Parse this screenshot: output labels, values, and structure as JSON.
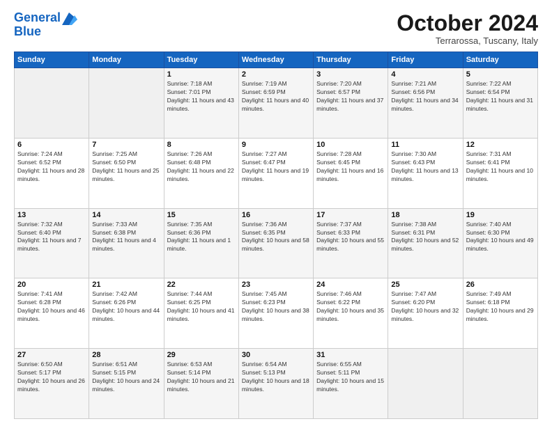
{
  "header": {
    "logo_line1": "General",
    "logo_line2": "Blue",
    "month_title": "October 2024",
    "location": "Terrarossa, Tuscany, Italy"
  },
  "days_of_week": [
    "Sunday",
    "Monday",
    "Tuesday",
    "Wednesday",
    "Thursday",
    "Friday",
    "Saturday"
  ],
  "weeks": [
    [
      {
        "day": "",
        "sunrise": "",
        "sunset": "",
        "daylight": ""
      },
      {
        "day": "",
        "sunrise": "",
        "sunset": "",
        "daylight": ""
      },
      {
        "day": "1",
        "sunrise": "Sunrise: 7:18 AM",
        "sunset": "Sunset: 7:01 PM",
        "daylight": "Daylight: 11 hours and 43 minutes."
      },
      {
        "day": "2",
        "sunrise": "Sunrise: 7:19 AM",
        "sunset": "Sunset: 6:59 PM",
        "daylight": "Daylight: 11 hours and 40 minutes."
      },
      {
        "day": "3",
        "sunrise": "Sunrise: 7:20 AM",
        "sunset": "Sunset: 6:57 PM",
        "daylight": "Daylight: 11 hours and 37 minutes."
      },
      {
        "day": "4",
        "sunrise": "Sunrise: 7:21 AM",
        "sunset": "Sunset: 6:56 PM",
        "daylight": "Daylight: 11 hours and 34 minutes."
      },
      {
        "day": "5",
        "sunrise": "Sunrise: 7:22 AM",
        "sunset": "Sunset: 6:54 PM",
        "daylight": "Daylight: 11 hours and 31 minutes."
      }
    ],
    [
      {
        "day": "6",
        "sunrise": "Sunrise: 7:24 AM",
        "sunset": "Sunset: 6:52 PM",
        "daylight": "Daylight: 11 hours and 28 minutes."
      },
      {
        "day": "7",
        "sunrise": "Sunrise: 7:25 AM",
        "sunset": "Sunset: 6:50 PM",
        "daylight": "Daylight: 11 hours and 25 minutes."
      },
      {
        "day": "8",
        "sunrise": "Sunrise: 7:26 AM",
        "sunset": "Sunset: 6:48 PM",
        "daylight": "Daylight: 11 hours and 22 minutes."
      },
      {
        "day": "9",
        "sunrise": "Sunrise: 7:27 AM",
        "sunset": "Sunset: 6:47 PM",
        "daylight": "Daylight: 11 hours and 19 minutes."
      },
      {
        "day": "10",
        "sunrise": "Sunrise: 7:28 AM",
        "sunset": "Sunset: 6:45 PM",
        "daylight": "Daylight: 11 hours and 16 minutes."
      },
      {
        "day": "11",
        "sunrise": "Sunrise: 7:30 AM",
        "sunset": "Sunset: 6:43 PM",
        "daylight": "Daylight: 11 hours and 13 minutes."
      },
      {
        "day": "12",
        "sunrise": "Sunrise: 7:31 AM",
        "sunset": "Sunset: 6:41 PM",
        "daylight": "Daylight: 11 hours and 10 minutes."
      }
    ],
    [
      {
        "day": "13",
        "sunrise": "Sunrise: 7:32 AM",
        "sunset": "Sunset: 6:40 PM",
        "daylight": "Daylight: 11 hours and 7 minutes."
      },
      {
        "day": "14",
        "sunrise": "Sunrise: 7:33 AM",
        "sunset": "Sunset: 6:38 PM",
        "daylight": "Daylight: 11 hours and 4 minutes."
      },
      {
        "day": "15",
        "sunrise": "Sunrise: 7:35 AM",
        "sunset": "Sunset: 6:36 PM",
        "daylight": "Daylight: 11 hours and 1 minute."
      },
      {
        "day": "16",
        "sunrise": "Sunrise: 7:36 AM",
        "sunset": "Sunset: 6:35 PM",
        "daylight": "Daylight: 10 hours and 58 minutes."
      },
      {
        "day": "17",
        "sunrise": "Sunrise: 7:37 AM",
        "sunset": "Sunset: 6:33 PM",
        "daylight": "Daylight: 10 hours and 55 minutes."
      },
      {
        "day": "18",
        "sunrise": "Sunrise: 7:38 AM",
        "sunset": "Sunset: 6:31 PM",
        "daylight": "Daylight: 10 hours and 52 minutes."
      },
      {
        "day": "19",
        "sunrise": "Sunrise: 7:40 AM",
        "sunset": "Sunset: 6:30 PM",
        "daylight": "Daylight: 10 hours and 49 minutes."
      }
    ],
    [
      {
        "day": "20",
        "sunrise": "Sunrise: 7:41 AM",
        "sunset": "Sunset: 6:28 PM",
        "daylight": "Daylight: 10 hours and 46 minutes."
      },
      {
        "day": "21",
        "sunrise": "Sunrise: 7:42 AM",
        "sunset": "Sunset: 6:26 PM",
        "daylight": "Daylight: 10 hours and 44 minutes."
      },
      {
        "day": "22",
        "sunrise": "Sunrise: 7:44 AM",
        "sunset": "Sunset: 6:25 PM",
        "daylight": "Daylight: 10 hours and 41 minutes."
      },
      {
        "day": "23",
        "sunrise": "Sunrise: 7:45 AM",
        "sunset": "Sunset: 6:23 PM",
        "daylight": "Daylight: 10 hours and 38 minutes."
      },
      {
        "day": "24",
        "sunrise": "Sunrise: 7:46 AM",
        "sunset": "Sunset: 6:22 PM",
        "daylight": "Daylight: 10 hours and 35 minutes."
      },
      {
        "day": "25",
        "sunrise": "Sunrise: 7:47 AM",
        "sunset": "Sunset: 6:20 PM",
        "daylight": "Daylight: 10 hours and 32 minutes."
      },
      {
        "day": "26",
        "sunrise": "Sunrise: 7:49 AM",
        "sunset": "Sunset: 6:18 PM",
        "daylight": "Daylight: 10 hours and 29 minutes."
      }
    ],
    [
      {
        "day": "27",
        "sunrise": "Sunrise: 6:50 AM",
        "sunset": "Sunset: 5:17 PM",
        "daylight": "Daylight: 10 hours and 26 minutes."
      },
      {
        "day": "28",
        "sunrise": "Sunrise: 6:51 AM",
        "sunset": "Sunset: 5:15 PM",
        "daylight": "Daylight: 10 hours and 24 minutes."
      },
      {
        "day": "29",
        "sunrise": "Sunrise: 6:53 AM",
        "sunset": "Sunset: 5:14 PM",
        "daylight": "Daylight: 10 hours and 21 minutes."
      },
      {
        "day": "30",
        "sunrise": "Sunrise: 6:54 AM",
        "sunset": "Sunset: 5:13 PM",
        "daylight": "Daylight: 10 hours and 18 minutes."
      },
      {
        "day": "31",
        "sunrise": "Sunrise: 6:55 AM",
        "sunset": "Sunset: 5:11 PM",
        "daylight": "Daylight: 10 hours and 15 minutes."
      },
      {
        "day": "",
        "sunrise": "",
        "sunset": "",
        "daylight": ""
      },
      {
        "day": "",
        "sunrise": "",
        "sunset": "",
        "daylight": ""
      }
    ]
  ]
}
